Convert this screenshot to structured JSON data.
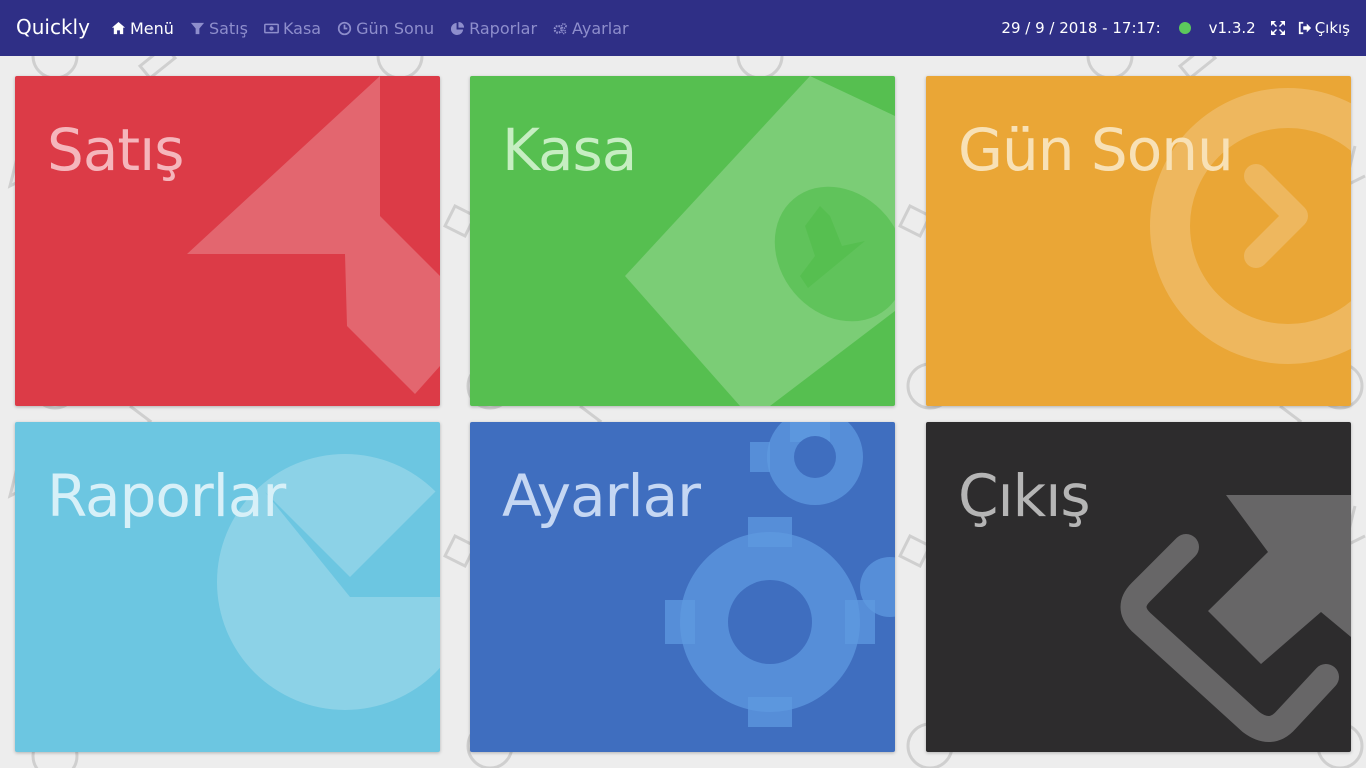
{
  "app": {
    "brand": "Quickly"
  },
  "nav": {
    "items": [
      {
        "label": "Menü",
        "icon": "home-icon",
        "active": true
      },
      {
        "label": "Satış",
        "icon": "funnel-icon"
      },
      {
        "label": "Kasa",
        "icon": "money-icon"
      },
      {
        "label": "Gün Sonu",
        "icon": "clock-icon"
      },
      {
        "label": "Raporlar",
        "icon": "pie-chart-icon"
      },
      {
        "label": "Ayarlar",
        "icon": "gears-icon"
      }
    ]
  },
  "header_right": {
    "datetime": "29 / 9 / 2018 - 17:17:",
    "status_color": "#5cc85c",
    "version": "v1.3.2",
    "fullscreen_icon": "expand-icon",
    "logout_label": "Çıkış",
    "logout_icon": "sign-out-icon"
  },
  "tiles": [
    {
      "label": "Satış",
      "color": "#dc3b47",
      "icon": "funnel-icon"
    },
    {
      "label": "Kasa",
      "color": "#56bf50",
      "icon": "money-icon"
    },
    {
      "label": "Gün Sonu",
      "color": "#eaa636",
      "icon": "chevron-circle-icon"
    },
    {
      "label": "Raporlar",
      "color": "#6cc6e1",
      "icon": "pie-chart-icon"
    },
    {
      "label": "Ayarlar",
      "color": "#3f6ebf",
      "icon": "gears-icon"
    },
    {
      "label": "Çıkış",
      "color": "#2d2c2d",
      "icon": "sign-out-icon"
    }
  ],
  "colors": {
    "navbar_bg": "#2f2f86",
    "page_bg": "#ededed"
  }
}
